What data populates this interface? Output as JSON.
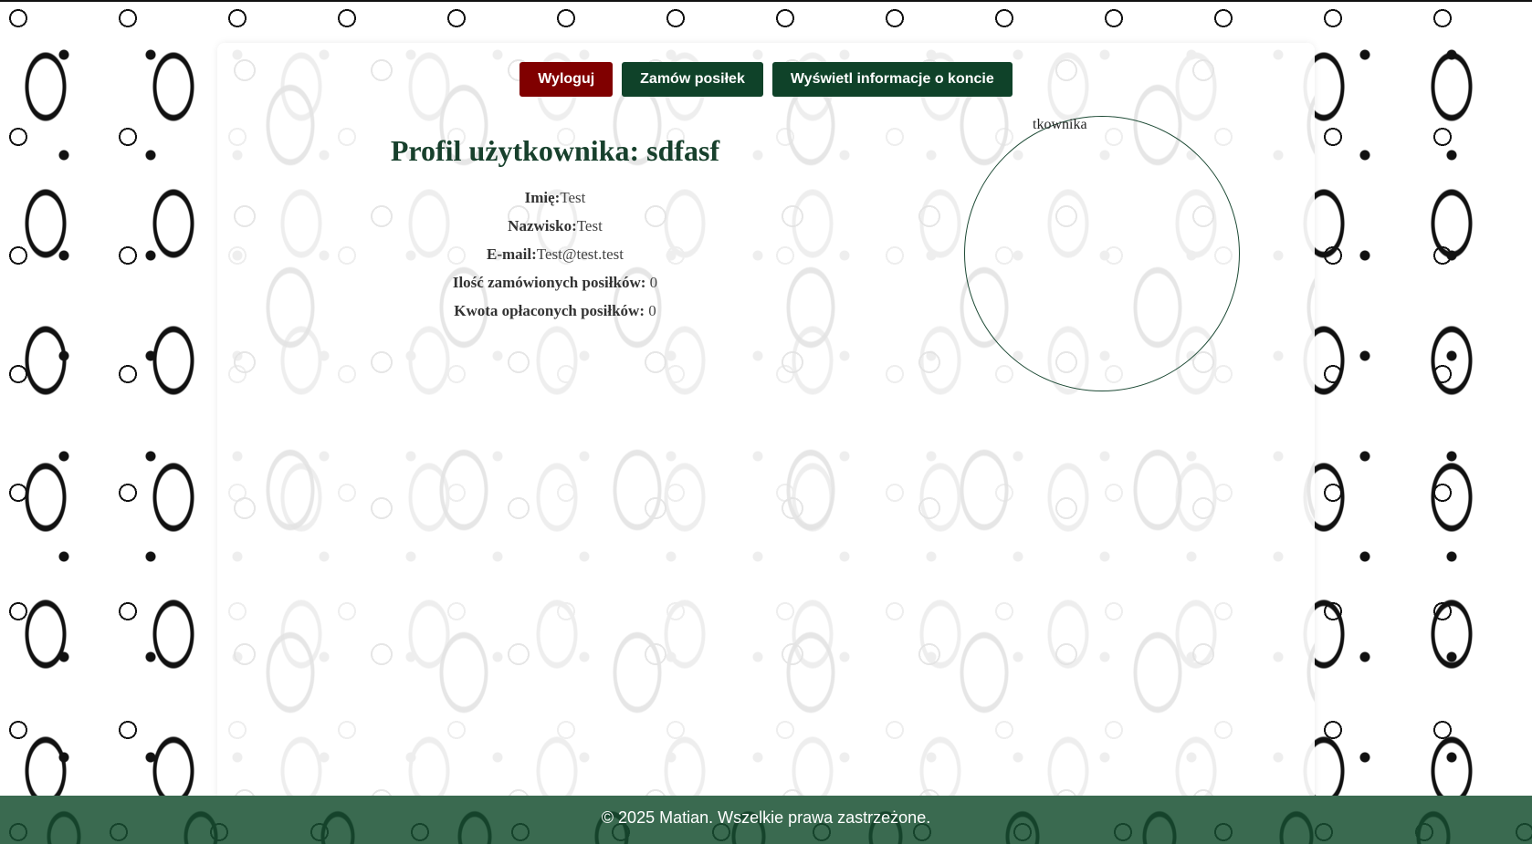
{
  "nav": {
    "logout_label": "Wyloguj",
    "order_label": "Zamów posiłek",
    "account_label": "Wyświetl informacje o koncie"
  },
  "profile": {
    "title": "Profil użytkownika: sdfasf",
    "first_name_label": "Imię:",
    "first_name_value": "Test",
    "last_name_label": "Nazwisko:",
    "last_name_value": "Test",
    "email_label": "E-mail:",
    "email_value": "Test@test.test",
    "orders_count_label": "Ilość zamówionych posiłków:",
    "orders_count_value": "0",
    "paid_amount_label": "Kwota opłaconych posiłków:",
    "paid_amount_value": "0"
  },
  "avatar": {
    "alt_text_fragment": "tkownika"
  },
  "footer": {
    "text": "© 2025 Matian. Wszelkie prawa zastrzeżone."
  },
  "colors": {
    "logout_button": "#800000",
    "primary_button": "#0f4229",
    "title": "#17402c",
    "footer": "#3a6a50"
  }
}
